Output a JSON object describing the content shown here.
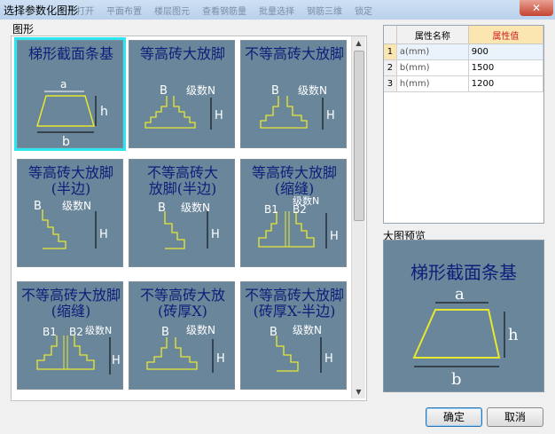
{
  "window": {
    "title": "选择参数化图形",
    "close_label": "✕"
  },
  "background_toolbar": [
    "已打开",
    "平面布置",
    "楼层图元",
    "查看钢筋量",
    "批量选择",
    "钢筋三维",
    "锁定"
  ],
  "gallery": {
    "label": "图形",
    "items": [
      {
        "caption": "梯形截面条基",
        "dims": [
          "a",
          "h",
          "b"
        ],
        "type": "trapezoid",
        "selected": true
      },
      {
        "caption": "等高砖大放脚",
        "dims": [
          "B",
          "级数N",
          "H"
        ],
        "type": "brick"
      },
      {
        "caption": "不等高砖大放脚",
        "dims": [
          "B",
          "级数N",
          "H"
        ],
        "type": "brick"
      },
      {
        "caption": "等高砖大放脚\n(半边)",
        "dims": [
          "B",
          "级数N",
          "H"
        ],
        "type": "half"
      },
      {
        "caption": "不等高砖大\n放脚(半边)",
        "dims": [
          "B",
          "级数N",
          "H"
        ],
        "type": "half"
      },
      {
        "caption": "等高砖大放脚\n(缩缝)",
        "dims": [
          "B1",
          "B2",
          "级数N",
          "H"
        ],
        "type": "joint"
      },
      {
        "caption": "不等高砖大放脚\n(缩缝)",
        "dims": [
          "B1",
          "B2",
          "级数N",
          "H"
        ],
        "type": "joint"
      },
      {
        "caption": "不等高砖大放\n(砖厚X)",
        "dims": [
          "B",
          "级数N",
          "H"
        ],
        "type": "brick"
      },
      {
        "caption": "不等高砖大放脚\n(砖厚X-半边)",
        "dims": [
          "B",
          "级数N",
          "H"
        ],
        "type": "half"
      }
    ]
  },
  "properties": {
    "headers": [
      "属性名称",
      "属性值"
    ],
    "rows": [
      {
        "index": "1",
        "name": "a(mm)",
        "value": "900"
      },
      {
        "index": "2",
        "name": "b(mm)",
        "value": "1500"
      },
      {
        "index": "3",
        "name": "h(mm)",
        "value": "1200"
      }
    ]
  },
  "preview": {
    "label": "大图预览",
    "caption": "梯形截面条基",
    "dims": [
      "a",
      "h",
      "b"
    ]
  },
  "buttons": {
    "ok": "确定",
    "cancel": "取消"
  },
  "colors": {
    "thumb_bg": "#6a869b",
    "caption": "#0b1f7a",
    "shape_line": "#e8e830",
    "selected_border": "#2ee6f2"
  }
}
